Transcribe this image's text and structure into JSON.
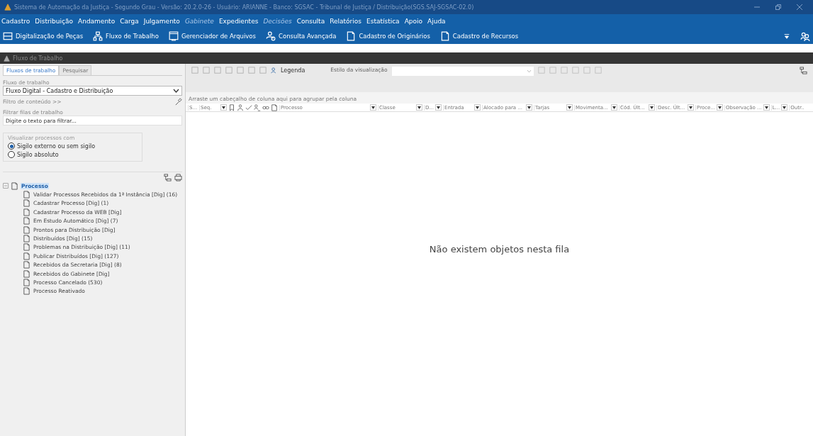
{
  "window": {
    "title": "Sistema de Automação da Justiça - Segundo Grau - Versão: 20.2.0-26 - Usuário: ARIANNE - Banco: SGSAC - Tribunal de Justiça / Distribuição(SGS.SAJ-SGSAC-02.0)"
  },
  "menu": [
    {
      "label": "Cadastro",
      "disabled": false
    },
    {
      "label": "Distribuição",
      "disabled": false
    },
    {
      "label": "Andamento",
      "disabled": false
    },
    {
      "label": "Carga",
      "disabled": false
    },
    {
      "label": "Julgamento",
      "disabled": false
    },
    {
      "label": "Gabinete",
      "disabled": true
    },
    {
      "label": "Expedientes",
      "disabled": false
    },
    {
      "label": "Decisões",
      "disabled": true
    },
    {
      "label": "Consulta",
      "disabled": false
    },
    {
      "label": "Relatórios",
      "disabled": false
    },
    {
      "label": "Estatística",
      "disabled": false
    },
    {
      "label": "Apoio",
      "disabled": false
    },
    {
      "label": "Ajuda",
      "disabled": false
    }
  ],
  "toolbar": [
    {
      "label": "Digitalização de Peças",
      "kind": "scan"
    },
    {
      "label": "Fluxo de Trabalho",
      "kind": "flow"
    },
    {
      "label": "Gerenciador de Arquivos",
      "kind": "files"
    },
    {
      "label": "Consulta Avançada",
      "kind": "search"
    },
    {
      "label": "Cadastro de Originários",
      "kind": "doc"
    },
    {
      "label": "Cadastro de Recursos",
      "kind": "doc"
    }
  ],
  "panel": {
    "title": "Fluxo de Trabalho"
  },
  "left": {
    "tabs": [
      {
        "label": "Fluxos de trabalho",
        "selected": true
      },
      {
        "label": "Pesquisar",
        "selected": false
      }
    ],
    "flow_label": "Fluxo de trabalho",
    "flow_value": "Fluxo Digital - Cadastro e Distribuição",
    "content_filter": "Filtro de conteúdo >>",
    "queue_filter_label": "Filtrar filas de trabalho",
    "queue_filter_placeholder": "Digite o texto para filtrar...",
    "view_group": "Visualizar processos com",
    "radios": [
      {
        "label": "Sigilo externo ou sem sigilo",
        "selected": true
      },
      {
        "label": "Sigilo absoluto",
        "selected": false
      }
    ],
    "tree": [
      {
        "label": "Processo",
        "selected": true,
        "expanded": true,
        "children": [
          {
            "label": "Validar Processos Recebidos da 1ª Instância [Dig] (16)",
            "selected": false
          },
          {
            "label": "Cadastrar Processo [Dig] (1)",
            "selected": false
          },
          {
            "label": "Cadastrar Processo da WEB [Dig]",
            "selected": false
          },
          {
            "label": "Em Estudo Automático [Dig] (7)",
            "selected": false
          },
          {
            "label": "Prontos para Distribuição [Dig]",
            "selected": false
          },
          {
            "label": "Distribuídos [Dig] (15)",
            "selected": false
          },
          {
            "label": "Problemas na Distribuição [Dig] (11)",
            "selected": false
          },
          {
            "label": "Publicar Distribuídos [Dig] (127)",
            "selected": false
          },
          {
            "label": "Recebidos da Secretaria [Dig] (8)",
            "selected": false
          },
          {
            "label": "Recebidos do Gabinete [Dig]",
            "selected": false
          },
          {
            "label": "Processo Cancelado (530)",
            "selected": false
          },
          {
            "label": "Processo Reativado",
            "selected": false
          }
        ]
      }
    ]
  },
  "grid_toolbar": {
    "legend": "Legenda",
    "view_style_label": "Estilo da visualização"
  },
  "group_hint": "Arraste um cabeçalho de coluna aqui para agrupar pela coluna",
  "columns": [
    {
      "kind": "text",
      "label": "S...",
      "filter": false
    },
    {
      "kind": "text",
      "label": "Seq.",
      "filter": true
    },
    {
      "kind": "icon"
    },
    {
      "kind": "icon"
    },
    {
      "kind": "icon"
    },
    {
      "kind": "icon"
    },
    {
      "kind": "icon"
    },
    {
      "kind": "icon"
    },
    {
      "kind": "text",
      "label": "Processo",
      "filter": true
    },
    {
      "kind": "text",
      "label": "Classe",
      "filter": true
    },
    {
      "kind": "text",
      "label": "D...",
      "filter": true
    },
    {
      "kind": "text",
      "label": "Entrada",
      "filter": true
    },
    {
      "kind": "text",
      "label": "Alocado para ...",
      "filter": true
    },
    {
      "kind": "text",
      "label": "Tarjas",
      "filter": true
    },
    {
      "kind": "text",
      "label": "Movimenta...",
      "filter": true
    },
    {
      "kind": "text",
      "label": "Cód. Últ...",
      "filter": true
    },
    {
      "kind": "text",
      "label": "Desc. Últ...",
      "filter": true
    },
    {
      "kind": "text",
      "label": "Proce...",
      "filter": true
    },
    {
      "kind": "text",
      "label": "Observação ...",
      "filter": true
    },
    {
      "kind": "text",
      "label": "L...",
      "filter": true
    },
    {
      "kind": "text",
      "label": "Outr..",
      "filter": false
    }
  ],
  "empty_message": "Não existem objetos nesta fila"
}
